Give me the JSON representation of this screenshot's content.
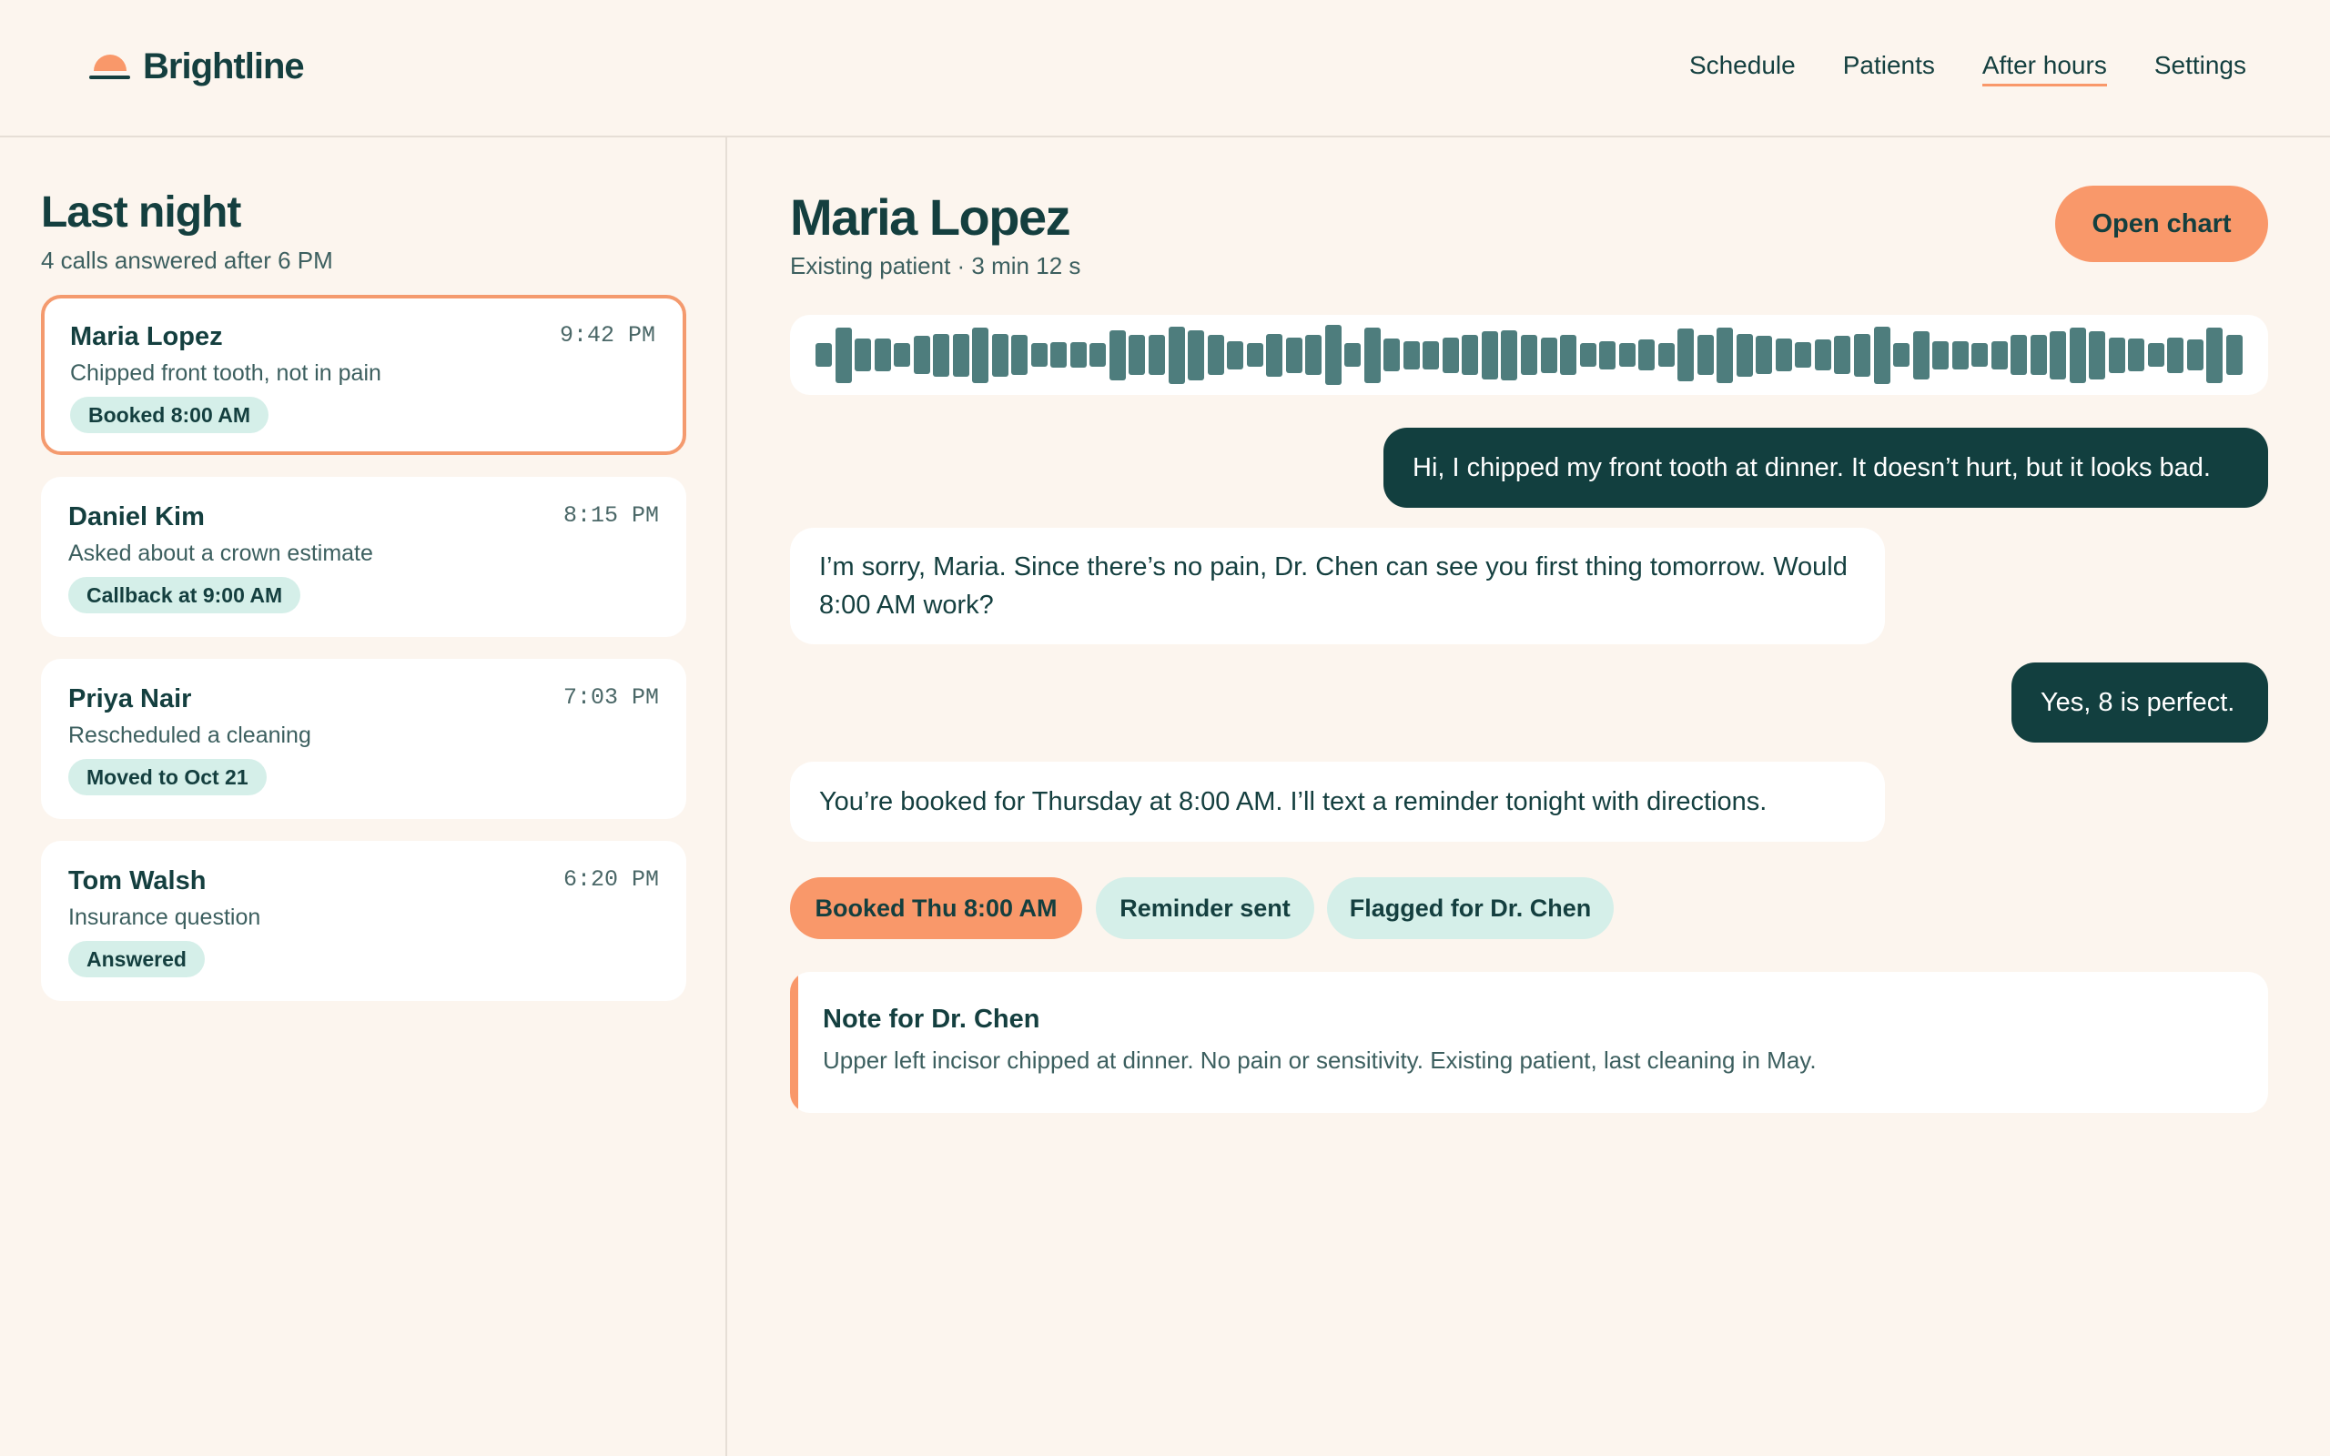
{
  "app": {
    "name": "Brightline",
    "nav": [
      "Schedule",
      "Patients",
      "After hours",
      "Settings"
    ],
    "active_nav": "After hours"
  },
  "sidebar": {
    "title": "Last night",
    "subtitle": "4 calls answered after 6 PM",
    "calls": [
      {
        "name": "Maria Lopez",
        "time": "9:42 PM",
        "desc": "Chipped front tooth, not in pain",
        "badge": "Booked 8:00 AM",
        "selected": true
      },
      {
        "name": "Daniel Kim",
        "time": "8:15 PM",
        "desc": "Asked about a crown estimate",
        "badge": "Callback at 9:00 AM",
        "selected": false
      },
      {
        "name": "Priya Nair",
        "time": "7:03 PM",
        "desc": "Rescheduled a cleaning",
        "badge": "Moved to Oct 21",
        "selected": false
      },
      {
        "name": "Tom Walsh",
        "time": "6:20 PM",
        "desc": "Insurance question",
        "badge": "Answered",
        "selected": false
      }
    ]
  },
  "detail": {
    "patient_name": "Maria Lopez",
    "patient_sub": "Existing patient · 3 min 12 s",
    "open_chart_label": "Open chart",
    "waveform_levels": [
      0.25,
      0.9,
      0.45,
      0.45,
      0.25,
      0.55,
      0.65,
      0.65,
      0.9,
      0.65,
      0.6,
      0.25,
      0.3,
      0.3,
      0.25,
      0.8,
      0.6,
      0.6,
      0.95,
      0.8,
      0.6,
      0.35,
      0.25,
      0.65,
      0.5,
      0.6,
      1.0,
      0.25,
      0.9,
      0.45,
      0.35,
      0.35,
      0.5,
      0.6,
      0.75,
      0.8,
      0.6,
      0.5,
      0.6,
      0.25,
      0.35,
      0.25,
      0.4,
      0.25,
      0.85,
      0.6,
      0.9,
      0.65,
      0.55,
      0.45,
      0.3,
      0.4,
      0.55,
      0.65,
      0.95,
      0.25,
      0.75,
      0.35,
      0.35,
      0.25,
      0.35,
      0.6,
      0.6,
      0.75,
      0.9,
      0.75,
      0.5,
      0.45,
      0.25,
      0.5,
      0.4,
      0.9,
      0.6
    ],
    "messages": [
      {
        "from": "patient",
        "text": "Hi, I chipped my front tooth at dinner. It doesn’t hurt, but it looks bad."
      },
      {
        "from": "assistant",
        "text": "I’m sorry, Maria. Since there’s no pain, Dr. Chen can see you first thing tomorrow. Would 8:00 AM work?"
      },
      {
        "from": "patient",
        "text": "Yes, 8 is perfect."
      },
      {
        "from": "assistant",
        "text": "You’re booked for Thursday at 8:00 AM. I’ll text a reminder tonight with directions."
      }
    ],
    "tags": [
      "Booked Thu 8:00 AM",
      "Reminder sent",
      "Flagged for Dr. Chen"
    ],
    "note": {
      "title": "Note for Dr. Chen",
      "body": "Upper left incisor chipped at dinner. No pain or sensitivity. Existing patient, last cleaning in May."
    }
  },
  "colors": {
    "background": "#fcf5ee",
    "primary_dark": "#123f3f",
    "accent_orange": "#f9986a",
    "mint": "#d5efe9",
    "waveform": "#4e7d7d"
  }
}
